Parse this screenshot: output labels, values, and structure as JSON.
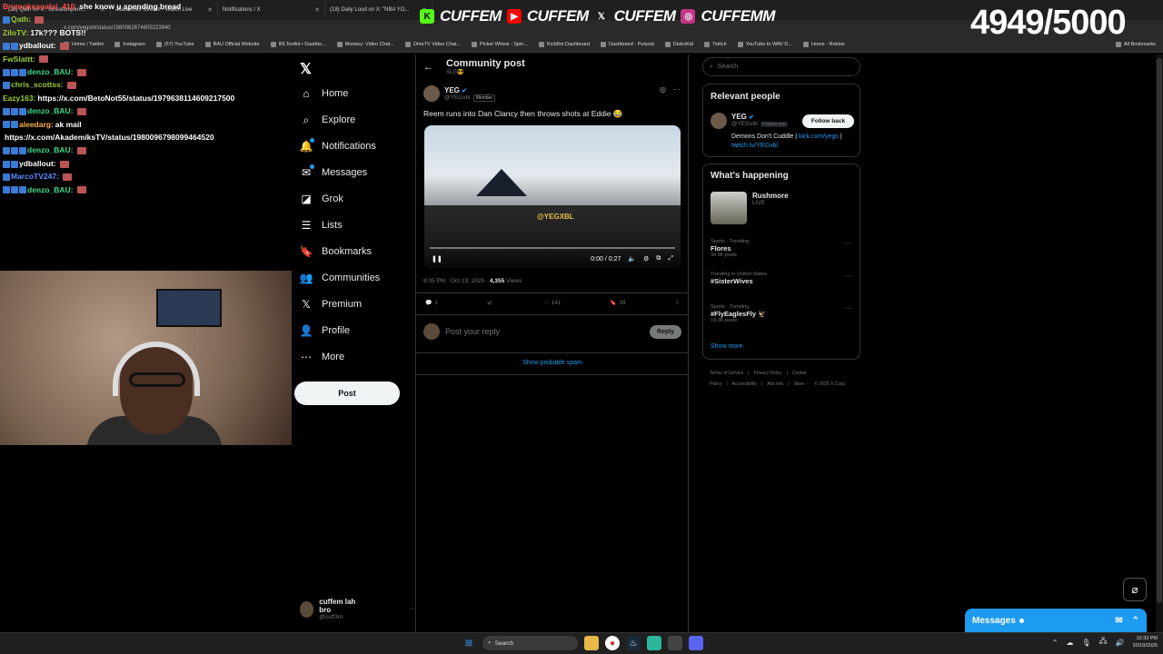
{
  "browser": {
    "tabs": [
      {
        "title": "(28) Qath on X: \"Brucedropem..."
      },
      {
        "title": "akademiks Stream - Watch Live"
      },
      {
        "title": "Notifications / X"
      },
      {
        "title": "(18) Daily Loud on X: \"NBA YO..."
      }
    ],
    "address": "x.com/yegxbl/status/1980062674605223940",
    "bookmarks": [
      "Home / Twitter",
      "Instagram",
      "(57) YouTube",
      "BAU Official Website",
      "IRLToolkit • Dashbo...",
      "Monkey: Video Chat...",
      "OmeTV Video Chat...",
      "Picker Wheel - Spin...",
      "KickBot Dashboard",
      "Dashboard - Pulsoid",
      "DistroKid",
      "Twitch",
      "YouTube to WAV D...",
      "Home - Roblox",
      "All Bookmarks"
    ]
  },
  "overlay": {
    "socials": [
      {
        "icon": "kick-icon",
        "glyph": "K",
        "bg": "#53fc18",
        "fg": "#000",
        "label": "CUFFEM"
      },
      {
        "icon": "youtube-icon",
        "glyph": "▶",
        "bg": "#ff0000",
        "fg": "#fff",
        "label": "CUFFEM"
      },
      {
        "icon": "x-logo-icon",
        "glyph": "𝕏",
        "bg": "transparent",
        "fg": "#fff",
        "label": "CUFFEM"
      },
      {
        "icon": "instagram-icon",
        "glyph": "◎",
        "bg": "#c13584",
        "fg": "#fff",
        "label": "CUFFEMM"
      }
    ],
    "counter": "4949/5000"
  },
  "chat": [
    {
      "user": "Brymokeaoalai_410:",
      "msg": "she know u spending bread",
      "color": "#ff4d4d",
      "badges": 0,
      "emote": false
    },
    {
      "user": "Qath:",
      "msg": "",
      "color": "#9acd32",
      "badges": 1,
      "emote": true
    },
    {
      "user": "ZiloTV:",
      "msg": "17k??? BOTS!!",
      "color": "#9acd32",
      "badges": 0,
      "emote": false
    },
    {
      "user": "ydballout:",
      "msg": "",
      "color": "#fff",
      "badges": 2,
      "emote": true
    },
    {
      "user": "FwSlattt:",
      "msg": "",
      "color": "#9acd32",
      "badges": 0,
      "emote": true
    },
    {
      "user": "denzo_BAU:",
      "msg": "",
      "color": "#3ddc84",
      "badges": 3,
      "emote": true
    },
    {
      "user": "chris_scottss:",
      "msg": "",
      "color": "#9acd32",
      "badges": 1,
      "emote": true
    },
    {
      "user": "Eazy163:",
      "msg": "https://x.com/BetoNot55/status/1979638114609217500",
      "color": "#9acd32",
      "badges": 0,
      "emote": false
    },
    {
      "user": "denzo_BAU:",
      "msg": "",
      "color": "#3ddc84",
      "badges": 3,
      "emote": true
    },
    {
      "user": "aleedarg:",
      "msg": "ak mail",
      "color": "#ffb347",
      "badges": 2,
      "emote": false
    },
    {
      "user": "",
      "msg": "https://x.com/AkademiksTV/status/1980096798099464520",
      "color": "#fff",
      "badges": 0,
      "emote": false
    },
    {
      "user": "denzo_BAU:",
      "msg": "",
      "color": "#3ddc84",
      "badges": 3,
      "emote": true
    },
    {
      "user": "ydballout:",
      "msg": "",
      "color": "#fff",
      "badges": 2,
      "emote": true
    },
    {
      "user": "MarcoTV247:",
      "msg": "",
      "color": "#5b8cff",
      "badges": 1,
      "emote": true
    },
    {
      "user": "denzo_BAU:",
      "msg": "",
      "color": "#3ddc84",
      "badges": 3,
      "emote": true
    }
  ],
  "xnav": {
    "items": [
      {
        "label": "Home",
        "icon": "home-icon",
        "glyph": "⌂",
        "badge": false
      },
      {
        "label": "Explore",
        "icon": "search-icon",
        "glyph": "⌕",
        "badge": false
      },
      {
        "label": "Notifications",
        "icon": "bell-icon",
        "glyph": "🔔",
        "badge": true
      },
      {
        "label": "Messages",
        "icon": "mail-icon",
        "glyph": "✉",
        "badge": true
      },
      {
        "label": "Grok",
        "icon": "grok-icon",
        "glyph": "◪",
        "badge": false
      },
      {
        "label": "Lists",
        "icon": "list-icon",
        "glyph": "☰",
        "badge": false
      },
      {
        "label": "Bookmarks",
        "icon": "bookmark-icon",
        "glyph": "🔖",
        "badge": false
      },
      {
        "label": "Communities",
        "icon": "people-icon",
        "glyph": "👥",
        "badge": false
      },
      {
        "label": "Premium",
        "icon": "x-logo-icon",
        "glyph": "𝕏",
        "badge": false
      },
      {
        "label": "Profile",
        "icon": "person-icon",
        "glyph": "👤",
        "badge": false
      },
      {
        "label": "More",
        "icon": "more-circle-icon",
        "glyph": "⋯",
        "badge": false
      }
    ],
    "post_label": "Post",
    "account": {
      "name": "cuffem lah bro",
      "handle": "@cuff3m"
    }
  },
  "post": {
    "header_title": "Community post",
    "header_sub": "SLG😎",
    "author_name": "YEG",
    "author_handle": "@YEGxbl",
    "member_badge": "Member",
    "text": "Reem runs into Dan Clancy then throws shots at Eddie 😂",
    "video_time": "0:00 / 0:27",
    "video_watermark": "@YEGXBL",
    "timestamp": "8:05 PM · Oct 19, 2025 ·",
    "views_count": "4,355",
    "views_label": "Views",
    "replies": "1",
    "reposts": "",
    "likes": "141",
    "bookmarks": "28",
    "reply_placeholder": "Post your reply",
    "reply_button": "Reply",
    "spam_link": "Show probable spam"
  },
  "sidebar": {
    "search_placeholder": "Search",
    "relevant_title": "Relevant people",
    "person_name": "YEG",
    "person_handle": "@YEGxbl",
    "follows_you": "Follows you",
    "follow_back": "Follow back",
    "bio_text": "Demons Don't Cuddle | ",
    "bio_link1": "kick.com/yegs",
    "bio_sep": " |",
    "bio_link2": "twitch.tv/YEGxbl",
    "happening_title": "What's happening",
    "live_name": "Rushmore",
    "live_status": "LIVE",
    "trends": [
      {
        "context": "Sports · Trending",
        "name": "Flores",
        "count": "34.9K posts"
      },
      {
        "context": "Trending in United States",
        "name": "#SisterWives",
        "count": ""
      },
      {
        "context": "Sports · Trending",
        "name": "#FlyEaglesFly 🦅",
        "count": "19.3K posts"
      }
    ],
    "show_more": "Show more",
    "footer": [
      "Terms of Service",
      "|",
      "Privacy Policy",
      "|",
      "Cookie Policy",
      "|",
      "Accessibility",
      "|",
      "Ads info",
      "|",
      "More ···",
      "© 2025 X Corp."
    ]
  },
  "messages_drawer": {
    "label": "Messages"
  },
  "taskbar": {
    "search": "Search",
    "time": "10:33 PM",
    "date": "10/19/2025"
  }
}
